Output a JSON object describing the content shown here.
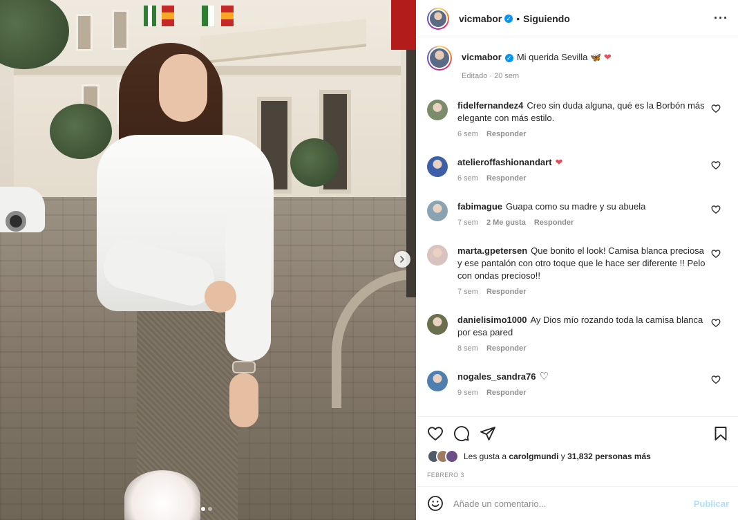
{
  "post": {
    "username": "vicmabor",
    "follow_status": "Siguiendo",
    "more_icon": "more-horizontal-icon",
    "caption": "Mi querida Sevilla 🦋",
    "caption_edited": "Editado · 20 sem",
    "likes_prefix": "Les gusta a",
    "likes_user": "carolgmundi",
    "likes_and": "y",
    "likes_count": "31,832 personas más",
    "date": "FEBRERO 3",
    "carousel_index": 1,
    "carousel_total": 2
  },
  "comments": [
    {
      "user": "fidelfernandez4",
      "text": "Creo sin duda alguna, qué es la Borbón más elegante con más estilo.",
      "time": "6 sem",
      "likes": "",
      "reply": "Responder",
      "heart": false,
      "avatar_color": "#7b8c6a"
    },
    {
      "user": "atelieroffashionandart",
      "text": "",
      "time": "6 sem",
      "likes": "",
      "reply": "Responder",
      "heart": true,
      "avatar_color": "#3c5fa8"
    },
    {
      "user": "fabimague",
      "text": "Guapa como su madre y su abuela",
      "time": "7 sem",
      "likes": "2 Me gusta",
      "reply": "Responder",
      "heart": false,
      "avatar_color": "#8aa3b3"
    },
    {
      "user": "marta.gpetersen",
      "text": "Que bonito el look! Camisa blanca preciosa y ese pantalón con otro toque que le hace ser diferente !! Pelo con ondas precioso!!",
      "time": "7 sem",
      "likes": "",
      "reply": "Responder",
      "heart": false,
      "avatar_color": "#d9c3bf"
    },
    {
      "user": "danielisimo1000",
      "text": "Ay Dios mío rozando toda la camisa blanca por esa pared",
      "time": "8 sem",
      "likes": "",
      "reply": "Responder",
      "heart": false,
      "avatar_color": "#6b6f4d"
    },
    {
      "user": "nogales_sandra76",
      "text": "",
      "time": "9 sem",
      "likes": "",
      "reply": "Responder",
      "heart": false,
      "avatar_color": "#4e7fb0"
    }
  ],
  "composer": {
    "placeholder": "Añade un comentario...",
    "publish": "Publicar"
  },
  "colors": {
    "accent": "#0095f6",
    "like_red": "#ed4956",
    "muted": "#8e8e8e"
  }
}
